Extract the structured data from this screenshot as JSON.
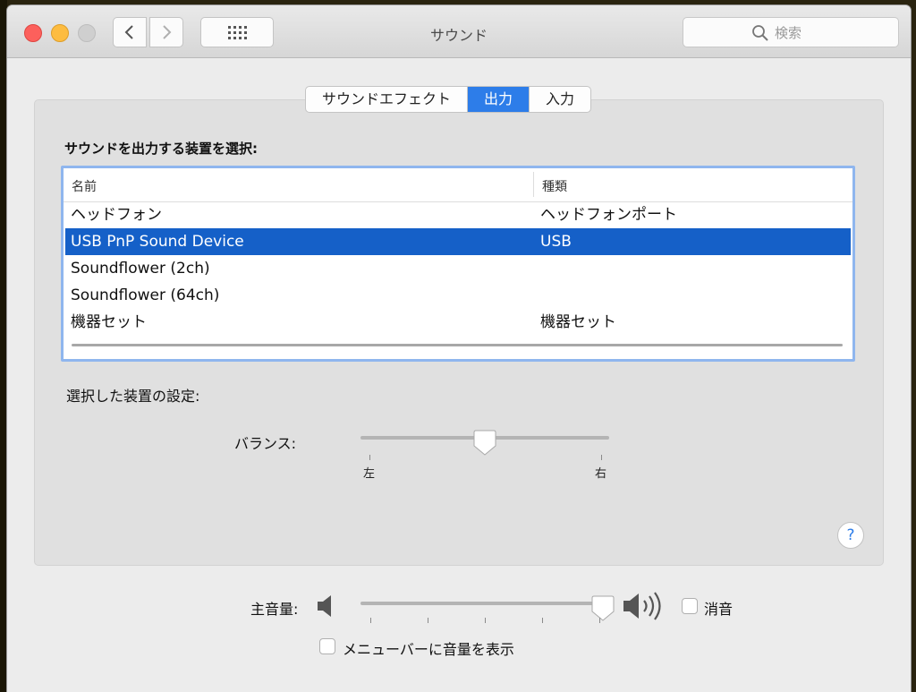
{
  "window": {
    "title": "サウンド",
    "search_placeholder": "検索"
  },
  "tabs": [
    {
      "label": "サウンドエフェクト",
      "active": false
    },
    {
      "label": "出力",
      "active": true
    },
    {
      "label": "入力",
      "active": false
    }
  ],
  "output": {
    "section_label": "サウンドを出力する装置を選択:",
    "columns": {
      "name": "名前",
      "type": "種類"
    },
    "devices": [
      {
        "name": "ヘッドフォン",
        "type": "ヘッドフォンポート",
        "selected": false
      },
      {
        "name": "USB PnP Sound Device",
        "type": "USB",
        "selected": true
      },
      {
        "name": "Soundflower (2ch)",
        "type": "",
        "selected": false
      },
      {
        "name": "Soundflower (64ch)",
        "type": "",
        "selected": false
      },
      {
        "name": "機器セット",
        "type": "機器セット",
        "selected": false
      }
    ]
  },
  "settings": {
    "label": "選択した装置の設定:",
    "balance": {
      "label": "バランス:",
      "left_label": "左",
      "right_label": "右",
      "value": 0.5
    }
  },
  "help": {
    "label": "?"
  },
  "volume": {
    "label": "主音量:",
    "value": 0.96,
    "mute_label": "消音",
    "mute_checked": false,
    "menubar_label": "メニューバーに音量を表示",
    "menubar_checked": false
  },
  "colors": {
    "accent": "#2d7de9",
    "selection": "#1560c8"
  }
}
